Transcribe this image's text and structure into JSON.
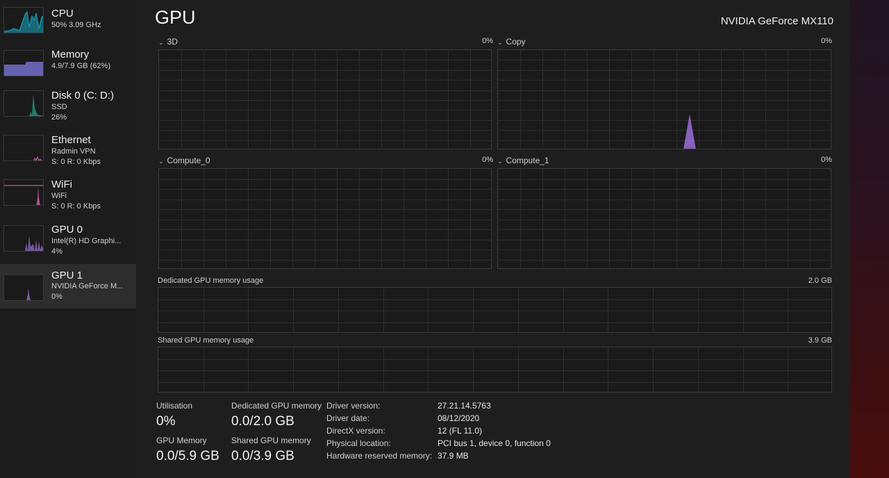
{
  "sidebar": {
    "items": [
      {
        "title": "CPU",
        "sub1": "50%  3.09 GHz",
        "sub2": "",
        "color": "#17a9c4",
        "icon": "cpu-thumbnail"
      },
      {
        "title": "Memory",
        "sub1": "4.9/7.9 GB (62%)",
        "sub2": "",
        "color": "#7a74d6",
        "icon": "memory-thumbnail"
      },
      {
        "title": "Disk 0 (C: D:)",
        "sub1": "SSD",
        "sub2": "26%",
        "color": "#26a58e",
        "icon": "disk-thumbnail"
      },
      {
        "title": "Ethernet",
        "sub1": "Radmin VPN",
        "sub2": "S: 0 R: 0 Kbps",
        "color": "#c660b0",
        "icon": "ethernet-thumbnail"
      },
      {
        "title": "WiFi",
        "sub1": "WiFi",
        "sub2": "S: 0 R: 0 Kbps",
        "color": "#e26aa6",
        "icon": "wifi-thumbnail"
      },
      {
        "title": "GPU 0",
        "sub1": "Intel(R) HD Graphi...",
        "sub2": "4%",
        "color": "#9b6fd6",
        "icon": "gpu0-thumbnail"
      },
      {
        "title": "GPU 1",
        "sub1": "NVIDIA GeForce M...",
        "sub2": "0%",
        "color": "#9b6fd6",
        "icon": "gpu1-thumbnail",
        "selected": true
      }
    ]
  },
  "header": {
    "title": "GPU",
    "device": "NVIDIA GeForce MX110"
  },
  "engines": [
    {
      "label": "3D",
      "percent": "0%"
    },
    {
      "label": "Copy",
      "percent": "0%"
    },
    {
      "label": "Compute_0",
      "percent": "0%"
    },
    {
      "label": "Compute_1",
      "percent": "0%"
    }
  ],
  "memory_graphs": {
    "dedicated": {
      "label": "Dedicated GPU memory usage",
      "max": "2.0 GB"
    },
    "shared": {
      "label": "Shared GPU memory usage",
      "max": "3.9 GB"
    }
  },
  "stats": {
    "utilisation": {
      "label": "Utilisation",
      "value": "0%"
    },
    "dedicated": {
      "label": "Dedicated GPU memory",
      "value": "0.0/2.0 GB"
    },
    "gpu_memory": {
      "label": "GPU Memory",
      "value": "0.0/5.9 GB"
    },
    "shared": {
      "label": "Shared GPU memory",
      "value": "0.0/3.9 GB"
    }
  },
  "info": [
    {
      "key": "Driver version:",
      "value": "27.21.14.5763"
    },
    {
      "key": "Driver date:",
      "value": "08/12/2020"
    },
    {
      "key": "DirectX version:",
      "value": "12 (FL 11.0)"
    },
    {
      "key": "Physical location:",
      "value": "PCI bus 1, device 0, function 0"
    },
    {
      "key": "Hardware reserved memory:",
      "value": "37.9 MB"
    }
  ],
  "colors": {
    "gpu_accent": "#9b6fd6",
    "grid": "#2e2e2e",
    "border": "#3b3b3b"
  }
}
